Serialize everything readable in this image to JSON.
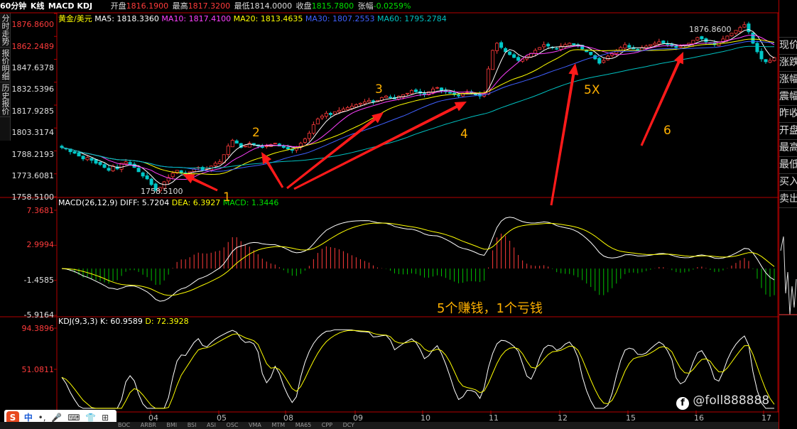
{
  "header": {
    "period": "60分钟",
    "chart_kind": "K线",
    "indicators": "MACD KDJ",
    "open_label": "开盘",
    "open_value": "1816.1900",
    "high_label": "最高",
    "high_value": "1817.3200",
    "low_label": "最低",
    "low_value": "1814.0000",
    "close_label": "收盘",
    "close_value": "1815.7800",
    "change_label": "张幅",
    "change_value": "-0.0259%"
  },
  "left_tabs": [
    "分时走势",
    "报价明细",
    "历史报价"
  ],
  "right_panel": [
    "现价",
    "涨跌",
    "涨幅",
    "震幅",
    "昨收",
    "开盘",
    "最高",
    "最低",
    "买入",
    "卖出"
  ],
  "colors": {
    "up": "#ff3b3b",
    "down": "#00c8c8",
    "ma5": "#ffffff",
    "ma10": "#ff40ff",
    "ma20": "#ffff00",
    "ma30": "#4060ff",
    "ma60": "#00c0c0",
    "diff": "#ffffff",
    "dea": "#ffff00",
    "macd_pos": "#ff3b3b",
    "macd_neg": "#00c000",
    "arrow": "#ff1a1a",
    "annot": "#ffb000"
  },
  "chart_data": [
    {
      "type": "candlestick",
      "legend": {
        "symbol": "黄金/美元",
        "ma5": "MA5: 1818.3360",
        "ma10": "MA10: 1817.4100",
        "ma20": "MA20: 1813.4635",
        "ma30": "MA30: 1807.2553",
        "ma60": "MA60: 1795.2784"
      },
      "y_ticks": [
        "1876.8600",
        "1862.2489",
        "1847.6378",
        "1832.5396",
        "1817.9285",
        "1803.3174",
        "1788.2193",
        "1773.6081",
        "1758.5100"
      ],
      "ylim": [
        1758.51,
        1876.86
      ],
      "x_ticks": [
        "04",
        "05",
        "08",
        "09",
        "10",
        "11",
        "12",
        "15",
        "16",
        "17"
      ],
      "max_label": "1876.8600",
      "min_label": "1758.5100",
      "close_path": [
        1790,
        1789,
        1787,
        1786,
        1784,
        1782,
        1783,
        1781,
        1779,
        1778,
        1776,
        1774,
        1777,
        1775,
        1779,
        1780,
        1778,
        1776,
        1773,
        1770,
        1768,
        1764,
        1760,
        1762,
        1766,
        1769,
        1772,
        1774,
        1772,
        1770,
        1773,
        1775,
        1776,
        1774,
        1775,
        1777,
        1779,
        1780,
        1785,
        1791,
        1795,
        1793,
        1790,
        1791,
        1793,
        1792,
        1791,
        1790,
        1791,
        1792,
        1793,
        1791,
        1790,
        1789,
        1788,
        1790,
        1793,
        1796,
        1800,
        1806,
        1810,
        1812,
        1814,
        1813,
        1815,
        1816,
        1817,
        1818,
        1819,
        1820,
        1821,
        1822,
        1823,
        1822,
        1823,
        1825,
        1826,
        1825,
        1824,
        1826,
        1827,
        1828,
        1830,
        1829,
        1828,
        1827,
        1829,
        1831,
        1832,
        1830,
        1829,
        1828,
        1827,
        1826,
        1828,
        1829,
        1828,
        1827,
        1826,
        1828,
        1845,
        1858,
        1863,
        1860,
        1857,
        1855,
        1853,
        1851,
        1852,
        1854,
        1856,
        1858,
        1860,
        1862,
        1861,
        1860,
        1859,
        1861,
        1862,
        1863,
        1862,
        1861,
        1859,
        1857,
        1855,
        1852,
        1849,
        1851,
        1854,
        1856,
        1858,
        1860,
        1862,
        1860,
        1859,
        1858,
        1860,
        1861,
        1862,
        1863,
        1864,
        1863,
        1862,
        1861,
        1860,
        1861,
        1862,
        1863,
        1865,
        1867,
        1866,
        1864,
        1863,
        1862,
        1864,
        1866,
        1868,
        1870,
        1872,
        1874,
        1876,
        1871,
        1863,
        1857,
        1852,
        1850,
        1851,
        1853
      ]
    },
    {
      "type": "macd",
      "legend": {
        "name": "MACD(26,12,9)",
        "diff": "DIFF: 5.7204",
        "dea": "DEA: 6.3927",
        "macd": "MACD: 1.3446"
      },
      "y_ticks": [
        "7.3681",
        "2.9994",
        "-1.4585",
        "-5.9164"
      ],
      "ylim": [
        -5.9164,
        7.3681
      ]
    },
    {
      "type": "kdj",
      "legend": {
        "name": "KDJ(9,3,3)",
        "k": "K: 60.9589",
        "d": "D: 72.3928"
      },
      "y_ticks": [
        "94.3896",
        "51.0811"
      ],
      "ylim": [
        20,
        94.3896
      ]
    }
  ],
  "annotations": {
    "labels": [
      "1",
      "2",
      "3",
      "4",
      "5X",
      "6"
    ],
    "summary": "5个赚钱，1个亏钱",
    "watermark": "@foll888888"
  },
  "toolbar": {
    "ime_chars": [
      "中",
      "•,",
      "🎤",
      "⌨",
      "👕",
      "⊞"
    ],
    "tabs": [
      "BOC",
      "ARBR",
      "BMI",
      "BSI",
      "ASI",
      "OSC",
      "VMA",
      "MTM",
      "MA65",
      "CPP",
      "DCY"
    ]
  }
}
